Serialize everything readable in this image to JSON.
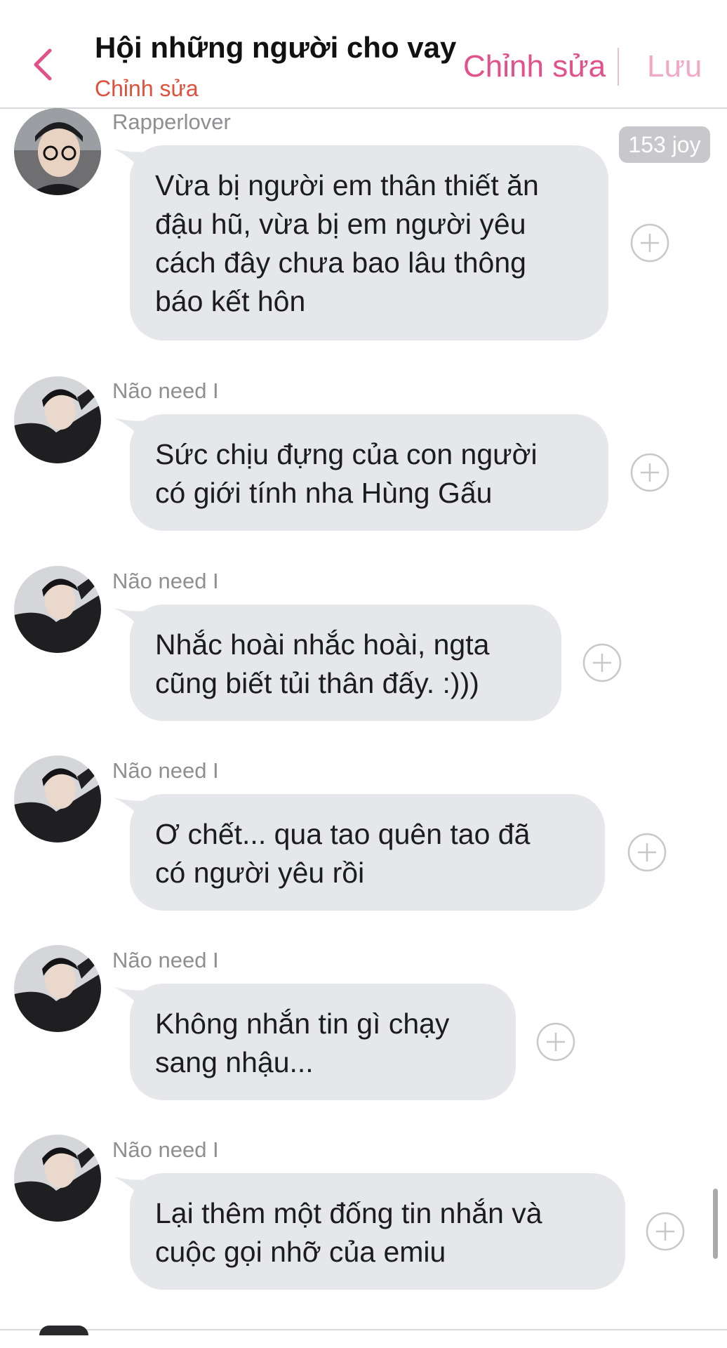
{
  "header": {
    "title": "Hội những người cho vay",
    "subtitle": "Chỉnh sửa",
    "edit_label": "Chỉnh sửa",
    "save_label": "Lưu",
    "accent_color": "#e2518b"
  },
  "joy_badge": "153 joy",
  "messages": [
    {
      "sender": "Rapperlover",
      "lines": [
        "Vừa bị người em thân thiết ăn",
        "đậu hũ, vừa bị em người yêu",
        "cách đây chưa bao lâu thông",
        "báo kết hôn"
      ]
    },
    {
      "sender": "Não need I",
      "lines": [
        "Sức chịu đựng của con người",
        "có giới tính nha Hùng Gấu"
      ]
    },
    {
      "sender": "Não need I",
      "lines": [
        "Nhắc hoài nhắc hoài, ngta",
        "cũng biết tủi thân đấy. :)))"
      ]
    },
    {
      "sender": "Não need I",
      "lines": [
        "Ơ chết... qua tao quên tao đã",
        "có người yêu rồi"
      ]
    },
    {
      "sender": "Não need I",
      "lines": [
        "Không nhắn tin gì chạy",
        "sang nhậu..."
      ]
    },
    {
      "sender": "Não need I",
      "lines": [
        "Lại thêm một đống tin nhắn và",
        "cuộc gọi nhỡ của emiu"
      ]
    }
  ]
}
